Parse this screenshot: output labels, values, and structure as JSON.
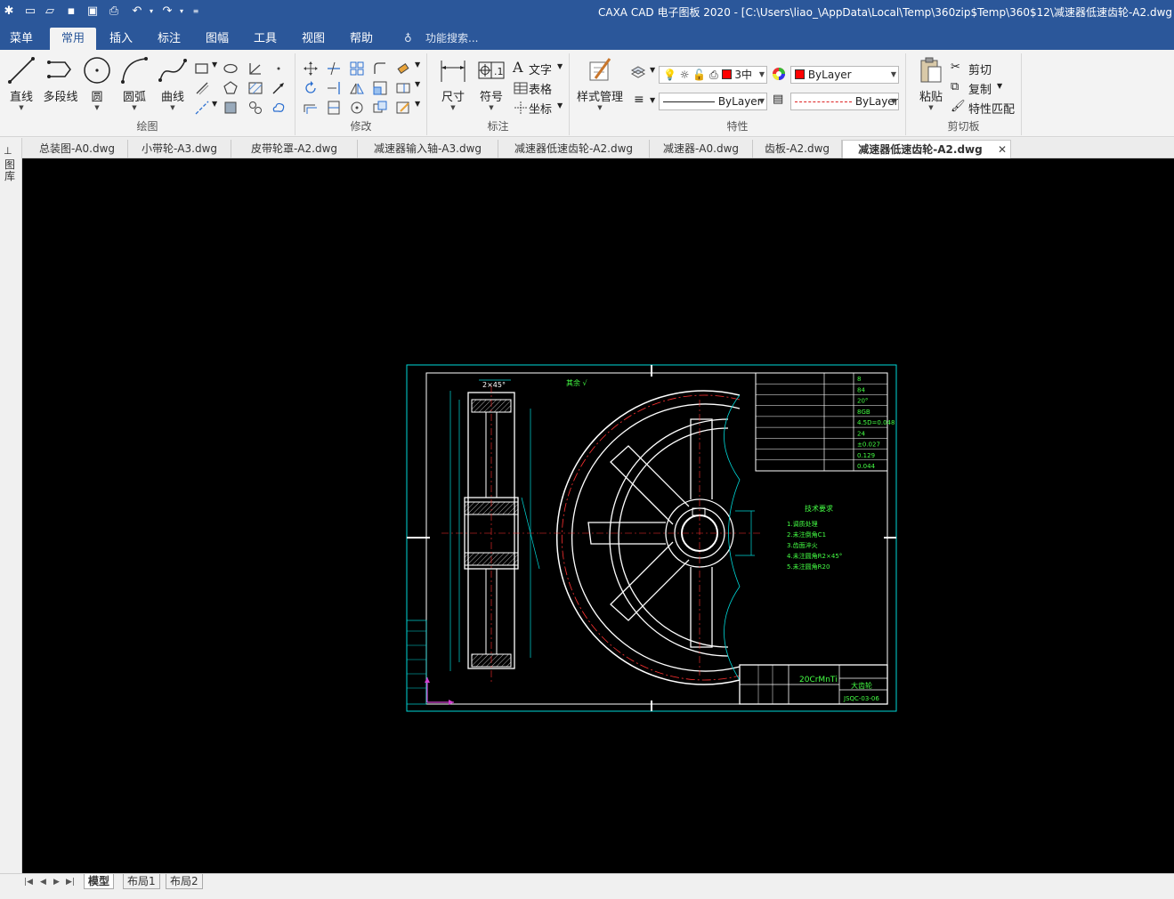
{
  "titlebar": {
    "title": "CAXA CAD 电子图板 2020 - [C:\\Users\\liao_\\AppData\\Local\\Temp\\360zip$Temp\\360$12\\减速器低速齿轮-A2.dwg"
  },
  "menu": {
    "tabs": [
      "菜单",
      "常用",
      "插入",
      "标注",
      "图幅",
      "工具",
      "视图",
      "帮助"
    ],
    "active": "常用",
    "search_placeholder": "功能搜索..."
  },
  "ribbon": {
    "draw": {
      "label": "绘图",
      "line": "直线",
      "polyline": "多段线",
      "circle": "圆",
      "arc": "圆弧",
      "curve": "曲线"
    },
    "modify": {
      "label": "修改"
    },
    "annotate": {
      "label": "标注",
      "dimension": "尺寸",
      "symbol": "符号",
      "text": "文字",
      "table": "表格",
      "coordinate": "坐标"
    },
    "properties": {
      "label": "特性",
      "style_manager": "样式管理",
      "layer_combo": "3中",
      "color_combo": "ByLayer",
      "linetype_combo": "ByLayer",
      "lineweight_combo": "ByLayer",
      "layer_color": "#ff0000"
    },
    "clipboard": {
      "label": "剪切板",
      "paste": "粘贴",
      "cut": "剪切",
      "copy": "复制",
      "match": "特性匹配"
    }
  },
  "doc_tabs": [
    "总装图-A0.dwg",
    "小带轮-A3.dwg",
    "皮带轮罩-A2.dwg",
    "减速器输入轴-A3.dwg",
    "减速器低速齿轮-A2.dwg",
    "减速器-A0.dwg",
    "齿板-A2.dwg",
    "减速器低速齿轮-A2.dwg"
  ],
  "active_doc_index": 7,
  "left_strip_label": "图库",
  "drawing": {
    "dim_top": "2×45°",
    "roughness_note": "其余 √",
    "tech_title": "技术要求",
    "tech_items": [
      "1.调质处理",
      "2.未注倒角C1",
      "3.齿面淬火",
      "4.未注圆角R2×45°",
      "5.未注圆角R20"
    ],
    "param_values": [
      "8",
      "84",
      "20°",
      "8GB",
      "4.5D=0.048",
      "24",
      "±0.027",
      "0.129",
      "0.044"
    ],
    "material": "20CrMnTi",
    "part_name": "大齿轮",
    "drawing_no": "JSQC-03-06"
  },
  "layout_tabs": [
    "模型",
    "布局1",
    "布局2"
  ],
  "active_layout": "模型"
}
